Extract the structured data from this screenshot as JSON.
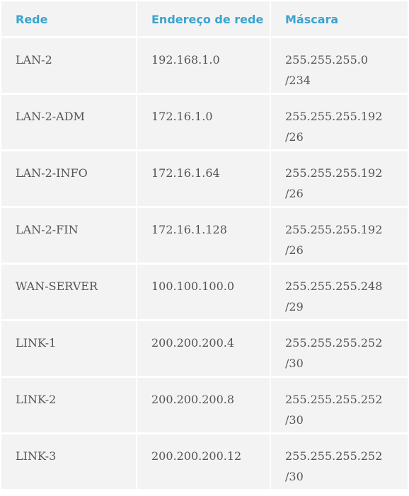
{
  "table": {
    "headers": [
      "Rede",
      "Endereço de rede",
      "Máscara"
    ],
    "rows": [
      {
        "rede": "LAN-2",
        "endereco": "192.168.1.0",
        "mascara": "255.255.255.0",
        "prefixo": "/234"
      },
      {
        "rede": "LAN-2-ADM",
        "endereco": "172.16.1.0",
        "mascara": "255.255.255.192",
        "prefixo": "/26"
      },
      {
        "rede": "LAN-2-INFO",
        "endereco": "172.16.1.64",
        "mascara": "255.255.255.192",
        "prefixo": "/26"
      },
      {
        "rede": "LAN-2-FIN",
        "endereco": "172.16.1.128",
        "mascara": "255.255.255.192",
        "prefixo": "/26"
      },
      {
        "rede": "WAN-SERVER",
        "endereco": "100.100.100.0",
        "mascara": "255.255.255.248",
        "prefixo": "/29"
      },
      {
        "rede": "LINK-1",
        "endereco": "200.200.200.4",
        "mascara": "255.255.255.252",
        "prefixo": "/30"
      },
      {
        "rede": "LINK-2",
        "endereco": "200.200.200.8",
        "mascara": "255.255.255.252",
        "prefixo": "/30"
      },
      {
        "rede": "LINK-3",
        "endereco": "200.200.200.12",
        "mascara": "255.255.255.252",
        "prefixo": "/30"
      }
    ]
  },
  "colors": {
    "header_text": "#3aa3cf",
    "cell_background": "#f3f3f3",
    "body_text": "#555555"
  }
}
